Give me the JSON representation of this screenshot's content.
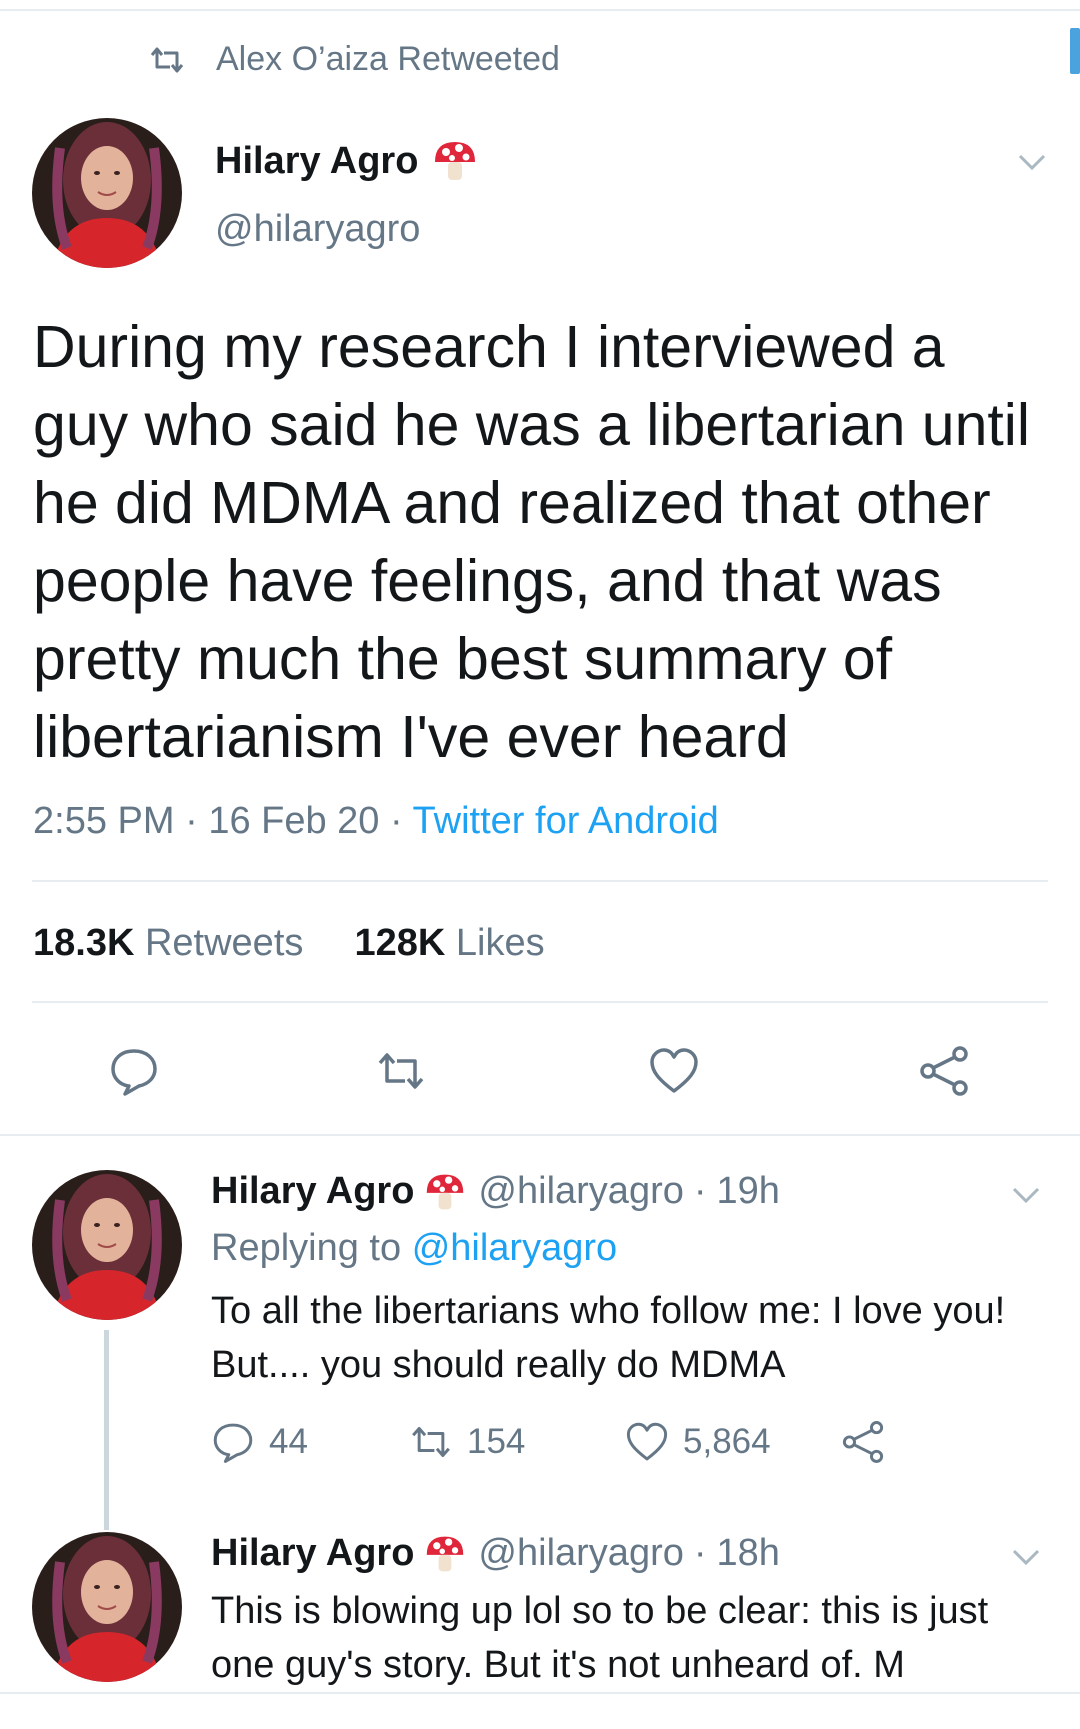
{
  "retweet_banner": {
    "text": "Alex O’aiza Retweeted"
  },
  "main_tweet": {
    "author_name": "Hilary Agro",
    "author_handle": "@hilaryagro",
    "text": "During my research I interviewed a guy who said he was a libertarian until he did MDMA and realized that other people have feelings, and that was pretty much the best summary of libertarianism I've ever heard",
    "time": "2:55 PM",
    "date": "16 Feb 20",
    "source": "Twitter for Android",
    "retweets_count": "18.3K",
    "retweets_label": "Retweets",
    "likes_count": "128K",
    "likes_label": "Likes"
  },
  "replies": [
    {
      "author_name": "Hilary Agro",
      "author_handle": "@hilaryagro",
      "age": "19h",
      "replying_prefix": "Replying to",
      "replying_to": "@hilaryagro",
      "text": "To all the libertarians who follow me: I love you! But.... you should really do MDMA",
      "reply_count": "44",
      "retweet_count": "154",
      "like_count": "5,864"
    },
    {
      "author_name": "Hilary Agro",
      "author_handle": "@hilaryagro",
      "age": "18h",
      "text": "This is blowing up lol so to be clear: this is just one guy's story. But it's not unheard of. M"
    }
  ],
  "colors": {
    "accent": "#1da1f2",
    "muted": "#657786",
    "text": "#14171a",
    "divider": "#e6ecf0"
  }
}
